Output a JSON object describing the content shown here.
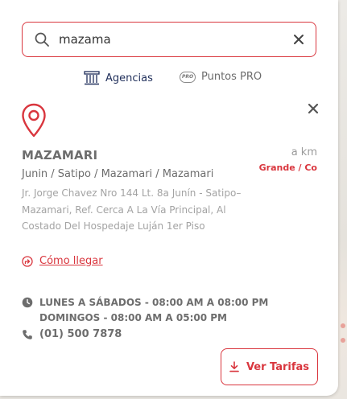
{
  "search": {
    "value": "mazama",
    "placeholder": ""
  },
  "filters": {
    "agencias_label": "Agencias",
    "pro_label": "Puntos PRO",
    "pro_badge": "PRO"
  },
  "agency": {
    "name": "MAZAMARI",
    "distance": "a km",
    "size": "Grande / Co",
    "region": "Junin / Satipo / Mazamari / Mazamari",
    "address": "Jr. Jorge Chavez Nro 144 Lt. 8a Junín - Satipo–Mazamari, Ref. Cerca A La Vía Principal, Al Costado Del Hospedaje Luján 1er Piso",
    "route_label": "Cómo llegar",
    "hours": [
      "LUNES A SÁBADOS - 08:00 AM A 08:00 PM",
      "DOMINGOS - 08:00 AM A 05:00 PM"
    ],
    "phone": "(01) 500 7878",
    "tarifas_label": "Ver Tarifas"
  },
  "icons": {
    "search": "search-icon",
    "clear": "close-icon",
    "agencias": "building-icon",
    "pro": "pro-badge-icon",
    "pin": "location-pin-icon",
    "route": "directions-icon",
    "clock": "clock-icon",
    "phone": "phone-icon",
    "download": "download-icon"
  },
  "colors": {
    "accent": "#d9363e",
    "navy": "#1f2e5a",
    "text": "#6d6d6d",
    "muted": "#a3a3a3"
  }
}
